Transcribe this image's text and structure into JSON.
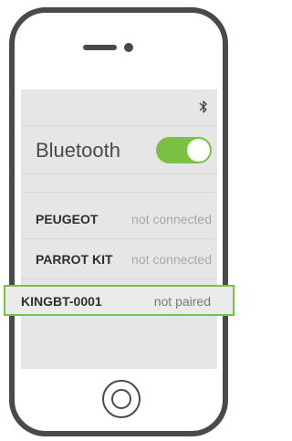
{
  "status_bar": {
    "icon": "bluetooth-icon"
  },
  "bluetooth": {
    "label": "Bluetooth",
    "enabled": true,
    "toggle_color": "#7ac142"
  },
  "devices": [
    {
      "name": "PEUGEOT",
      "status": "not connected"
    },
    {
      "name": "PARROT KIT",
      "status": "not connected"
    },
    {
      "name": "KINGBT-0001",
      "status": "not paired",
      "highlighted": true,
      "highlight_color": "#7ac142"
    }
  ],
  "colors": {
    "frame": "#4a4a4a",
    "screen": "#e6e6e6",
    "accent": "#7ac142"
  }
}
